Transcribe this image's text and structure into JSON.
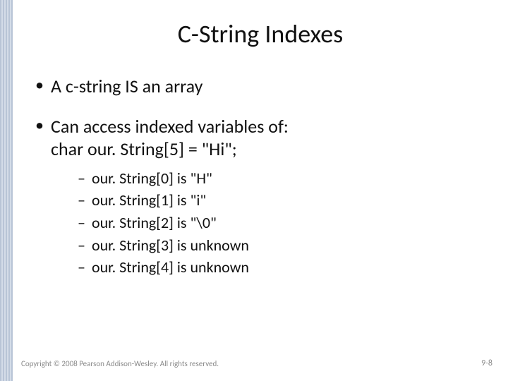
{
  "title": "C-String Indexes",
  "bullets": [
    {
      "text": "A c-string IS an array"
    },
    {
      "text": "Can access indexed variables of:",
      "subline": "char our. String[5] = \"Hi\";",
      "children": [
        "our. String[0] is \"H\"",
        "our. String[1] is \"i\"",
        "our. String[2] is \"\\0\"",
        "our. String[3] is unknown",
        "our. String[4] is unknown"
      ]
    }
  ],
  "footer": {
    "copyright": "Copyright © 2008 Pearson Addison-Wesley. All rights reserved.",
    "page": "9-8"
  }
}
